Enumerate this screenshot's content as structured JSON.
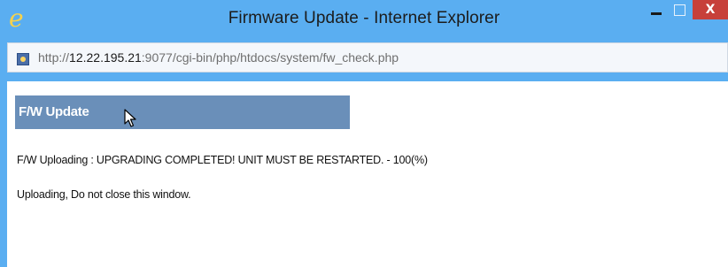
{
  "window": {
    "title": "Firmware Update - Internet Explorer",
    "icon": "internet-explorer-icon",
    "close_label": "X"
  },
  "address_bar": {
    "url_scheme": "http://",
    "url_host": "12.22.195.21",
    "url_path": ":9077/cgi-bin/php/htdocs/system/fw_check.php",
    "page_icon": "page-icon"
  },
  "panel": {
    "title": "F/W Update"
  },
  "status": {
    "upload_text": "F/W Uploading : UPGRADING COMPLETED! UNIT MUST BE RESTARTED. - 100(%)",
    "notice_text": "Uploading, Do not close this window."
  },
  "colors": {
    "chrome": "#5aaef1",
    "panel_header": "#6a8fb9",
    "close_button": "#c7403a"
  }
}
